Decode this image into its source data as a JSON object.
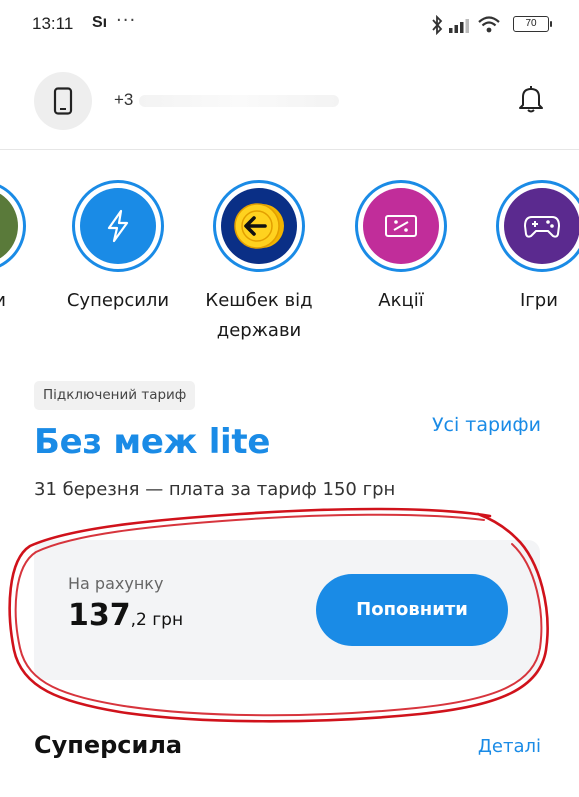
{
  "status_bar": {
    "time": "13:11",
    "carrier": "Sı",
    "more": "···",
    "battery": "70"
  },
  "header": {
    "phone_prefix": "+3",
    "avatar_icon": "phone-icon",
    "notifications_icon": "bell-icon"
  },
  "services": [
    {
      "label": "кити",
      "icon": "card-icon",
      "color": "#5a7a3a"
    },
    {
      "label": "Суперсили",
      "icon": "lightning-icon",
      "color": "#1a8be6"
    },
    {
      "label": "Кешбек від держави",
      "icon": "coin-arrow-icon",
      "color": "#0a2f86"
    },
    {
      "label": "Акції",
      "icon": "ticket-icon",
      "color": "#c12d9a"
    },
    {
      "label": "Ігри",
      "icon": "gamepad-icon",
      "color": "#5b2a8f"
    }
  ],
  "tariff": {
    "tag": "Підключений тариф",
    "all_link": "Усі тарифи",
    "name": "Без меж lite",
    "subtitle": "31 березня — плата за тариф 150 грн"
  },
  "balance": {
    "label": "На рахунку",
    "amount_int": "137",
    "amount_rest": ",2 грн",
    "button": "Поповнити"
  },
  "superpower": {
    "title": "Суперсила",
    "details_link": "Деталі"
  },
  "colors": {
    "accent": "#1a8be6",
    "annotation": "#d0121b"
  }
}
